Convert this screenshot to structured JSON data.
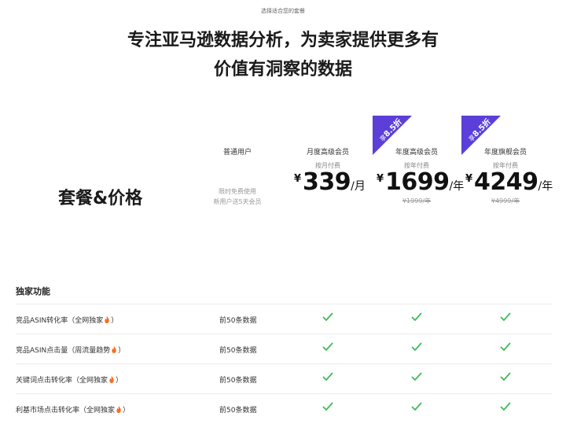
{
  "header": {
    "eyebrow": "选择适合您的套餐",
    "headline_line1": "专注亚马逊数据分析，为卖家提供更多有",
    "headline_line2": "价值有洞察的数据"
  },
  "plans_title": "套餐&价格",
  "plans": [
    {
      "name": "普通用户",
      "note_line1": "限时免费使用",
      "note_line2": "新用户送5天会员"
    },
    {
      "name": "月度高级会员",
      "billing": "按月付费",
      "currency": "¥",
      "price": "339",
      "unit": "/月"
    },
    {
      "name": "年度高级会员",
      "billing": "按年付费",
      "currency": "¥",
      "price": "1699",
      "unit": "/年",
      "original": "¥1999/年",
      "badge_prefix": "享",
      "badge_discount": "8.5折"
    },
    {
      "name": "年度旗舰会员",
      "billing": "按年付费",
      "currency": "¥",
      "price": "4249",
      "unit": "/年",
      "original": "¥4999/年",
      "badge_prefix": "享",
      "badge_discount": "8.5折"
    }
  ],
  "section_title": "独家功能",
  "features": [
    {
      "name_before": "竞品ASIN转化率（全网独家",
      "name_after": "）",
      "basic": "前50条数据"
    },
    {
      "name_before": "竞品ASIN点击量（周流量趋势",
      "name_after": "）",
      "basic": "前50条数据"
    },
    {
      "name_before": "关键词点击转化率（全网独家",
      "name_after": "）",
      "basic": "前50条数据"
    },
    {
      "name_before": "利基市场点击转化率（全网独家",
      "name_after": "）",
      "basic": "前50条数据"
    }
  ],
  "colors": {
    "badge": "#5b3fd8",
    "check": "#3dbb55",
    "flame": "#ff6b1a"
  },
  "icons": {
    "check": "check-icon",
    "flame": "flame-icon"
  }
}
